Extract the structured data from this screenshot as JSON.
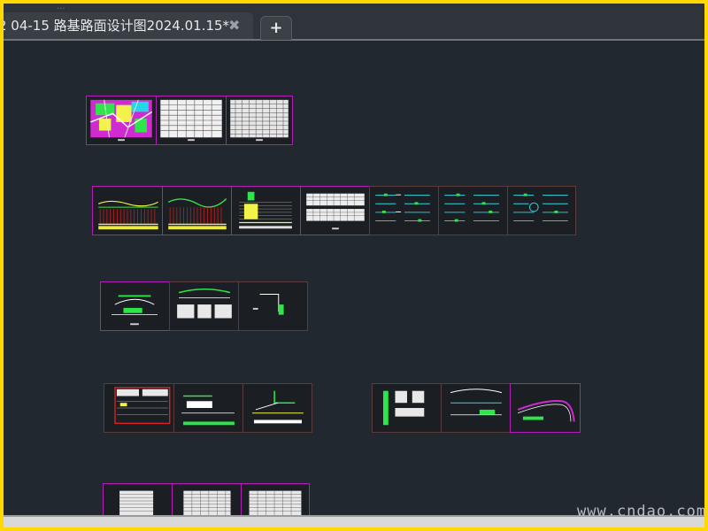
{
  "window": {
    "tab_title": "2 04-15 路基路面设计图2024.01.15*",
    "close_glyph": "✖",
    "new_tab_glyph": "+",
    "top_text": "..."
  },
  "watermark": "www.cndao.com",
  "colors": {
    "background": "#212830",
    "sheet_border_selected": "#b21bb6",
    "sheet_border": "#5a3c3c",
    "outer_frame": "#ffd800"
  },
  "drawing_groups": [
    {
      "name": "group-1",
      "sheets": 3
    },
    {
      "name": "group-2",
      "sheets": 7
    },
    {
      "name": "group-3",
      "sheets": 3
    },
    {
      "name": "group-4a",
      "sheets": 3
    },
    {
      "name": "group-4b",
      "sheets": 3
    },
    {
      "name": "group-5",
      "sheets": 3
    }
  ]
}
